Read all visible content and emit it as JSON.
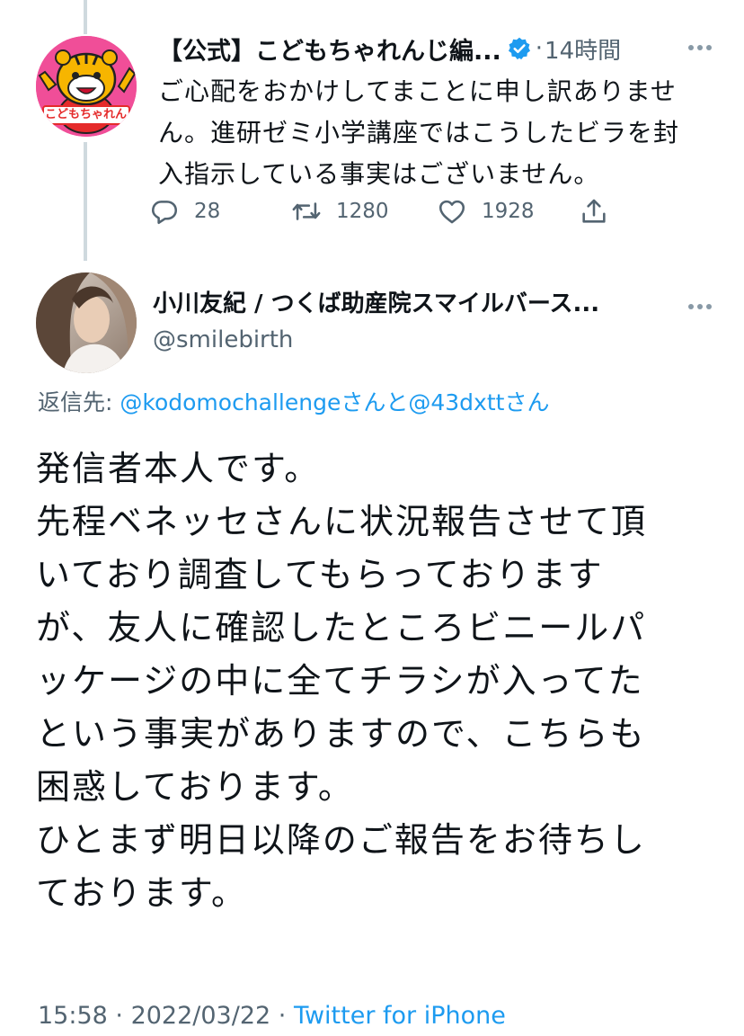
{
  "parent_tweet": {
    "name": "【公式】こどもちゃれんじ編...",
    "separator": "·",
    "time": "14時間",
    "text": "ご心配をおかけしてまことに申し訳ありません。進研ゼミ小学講座ではこうしたビラを封入指示している事実はございません。",
    "lines": [
      "ご心配をおかけしてまことに申し訳ありませ",
      "ん。進研ゼミ小学講座ではこうしたビラを封",
      "入指示している事実はございません。"
    ],
    "avatar_logo_text": "こどもちゃれんじ",
    "actions": {
      "reply_count": "28",
      "retweet_count": "1280",
      "like_count": "1928"
    }
  },
  "reply_tweet": {
    "name": "小川友紀 / つくば助産院スマイルバース...",
    "handle": "@smilebirth",
    "replying_prefix": "返信先: ",
    "mention_1": "@kodomochallenge",
    "mention_sep_1": "さんと",
    "mention_2": "@43dxtt",
    "mention_sep_2": "さん",
    "lines": [
      "発信者本人です。",
      "先程ベネッセさんに状況報告させて頂",
      "いており調査してもらっております",
      "が、友人に確認したところビニールパ",
      "ッケージの中に全てチラシが入ってた",
      "という事実がありますので、こちらも",
      "困惑しております。",
      "ひとまず明日以降のご報告をお待ちし",
      "ております。"
    ]
  },
  "meta": {
    "time": "15:58",
    "sep1": " · ",
    "date": "2022/03/22",
    "sep2": " · ",
    "source": "Twitter for iPhone"
  },
  "colors": {
    "link": "#1d9bf0",
    "muted": "#536471",
    "verified": "#1d9bf0",
    "avatar_bg": "#f04e98"
  },
  "icons": [
    "verified-badge-icon",
    "more-icon",
    "reply-icon",
    "retweet-icon",
    "like-icon",
    "share-icon"
  ]
}
